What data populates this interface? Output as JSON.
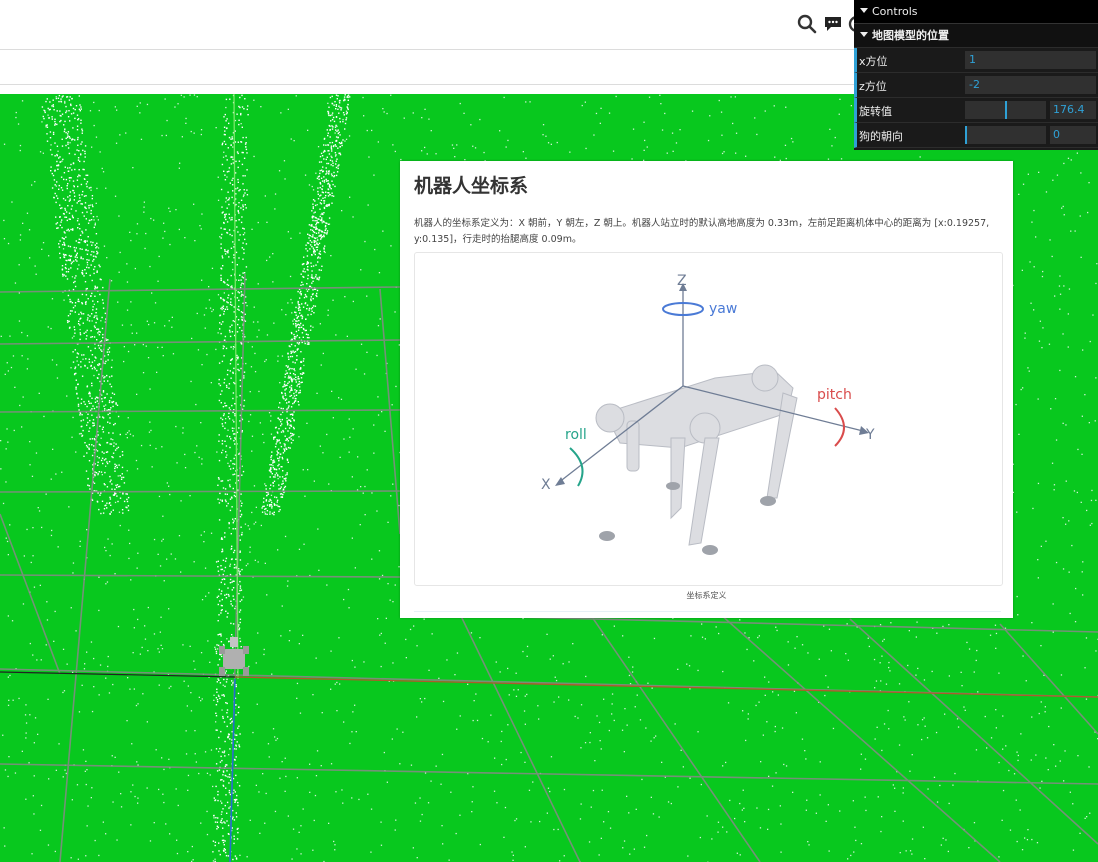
{
  "controls": {
    "title": "Controls",
    "folder": "地图模型的位置",
    "rows": [
      {
        "label": "x方位",
        "value": "1"
      },
      {
        "label": "z方位",
        "value": "-2"
      },
      {
        "label": "旋转值",
        "value": "176.4",
        "fraction": 0.49
      },
      {
        "label": "狗的朝向",
        "value": "0",
        "fraction": 0.0
      }
    ]
  },
  "doc": {
    "title": "机器人坐标系",
    "body": "机器人的坐标系定义为：X 朝前，Y 朝左，Z 朝上。机器人站立时的默认高地高度为 0.33m，左前足距离机体中心的距离为 [x:0.19257, y:0.135]，行走时的抬腿高度 0.09m。",
    "caption": "坐标系定义",
    "figure_labels": {
      "z": "Z",
      "yaw": "yaw",
      "pitch": "pitch",
      "y": "Y",
      "roll": "roll",
      "x": "X"
    }
  },
  "icons": [
    "search-icon",
    "chat-icon",
    "settings-icon"
  ],
  "colors": {
    "scene": "#08c81e",
    "accent": "#2fa1d6",
    "panel": "#1a1a1a"
  }
}
